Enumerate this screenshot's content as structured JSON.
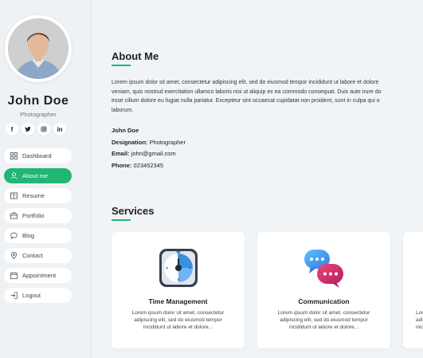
{
  "profile": {
    "name": "John Doe",
    "role": "Photographer"
  },
  "socials": [
    {
      "icon": "facebook-icon",
      "glyph": "f"
    },
    {
      "icon": "twitter-icon",
      "glyph": "t"
    },
    {
      "icon": "instagram-icon",
      "glyph": "◎"
    },
    {
      "icon": "linkedin-icon",
      "glyph": "in"
    }
  ],
  "nav": [
    {
      "label": "Dashboard",
      "icon": "dashboard-icon",
      "active": false
    },
    {
      "label": "About me",
      "icon": "user-icon",
      "active": true
    },
    {
      "label": "Resume",
      "icon": "resume-icon",
      "active": false
    },
    {
      "label": "Portfolio",
      "icon": "briefcase-icon",
      "active": false
    },
    {
      "label": "Blog",
      "icon": "chat-icon",
      "active": false
    },
    {
      "label": "Contact",
      "icon": "location-icon",
      "active": false
    },
    {
      "label": "Appointment",
      "icon": "calendar-icon",
      "active": false
    },
    {
      "label": "Logout",
      "icon": "logout-icon",
      "active": false
    }
  ],
  "about": {
    "title": "About Me",
    "lines": [
      "Lorem ipsum dolor sit amet, consectetur adipiscing elit, sed do eiusmod tempor incididunt ut labore et dolore",
      "veniam, quis nostrud exercitation ullamco laboris nisi ut aliquip ex ea commodo consequat. Duis aute irure do",
      "esse cillum dolore eu fugiat nulla pariatur. Excepteur sint occaecat cupidatat non proident, sunt in culpa qui o",
      "laborum."
    ],
    "details": [
      {
        "label": "John Doe",
        "value": ""
      },
      {
        "label": "Designation:",
        "value": "Photographer"
      },
      {
        "label": "Email:",
        "value": "john@gmail.com"
      },
      {
        "label": "Phone:",
        "value": "023452345"
      }
    ]
  },
  "services": {
    "title": "Services",
    "items": [
      {
        "title": "Time Management",
        "icon": "clock-icon",
        "lines": [
          "Lorem ipsum dolor sit amet, consectetur",
          "adipiscing elit, sed do eiusmod tempor",
          "incididunt ut labore et dolore..."
        ]
      },
      {
        "title": "Communication",
        "icon": "chat-bubbles-icon",
        "lines": [
          "Lorem ipsum dolor sit amet, consectetur",
          "adipiscing elit, sed do eiusmod tempor",
          "incididunt ut labore et dolore..."
        ]
      },
      {
        "title": "",
        "icon": "",
        "lines": [
          "Lore",
          "adip",
          "inci"
        ]
      }
    ]
  },
  "colors": {
    "accent": "#22b573",
    "background": "#f1f4f7"
  }
}
